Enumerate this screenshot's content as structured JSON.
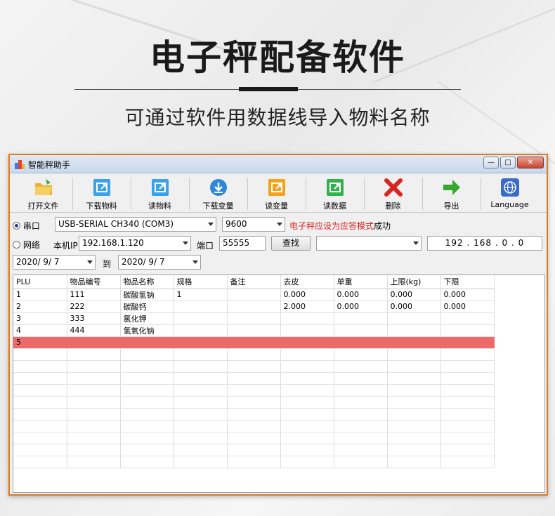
{
  "hero": {
    "title": "电子秤配备软件",
    "subtitle": "可通过软件用数据线导入物料名称"
  },
  "window": {
    "title": "智能秤助手",
    "controls": [
      "minimize",
      "restore",
      "close"
    ]
  },
  "toolbar": {
    "items": [
      {
        "label": "打开文件",
        "icon": "folder-open-icon",
        "color": "#e9b13a"
      },
      {
        "label": "下载物料",
        "icon": "download-item-icon",
        "color": "#3aa2e8"
      },
      {
        "label": "读物料",
        "icon": "read-item-icon",
        "color": "#3aa2e8"
      },
      {
        "label": "下载变量",
        "icon": "download-arrow-icon",
        "color": "#2b88d8"
      },
      {
        "label": "读变量",
        "icon": "read-variable-icon",
        "color": "#f2a21b"
      },
      {
        "label": "读数据",
        "icon": "read-data-icon",
        "color": "#2fb24b"
      },
      {
        "label": "删除",
        "icon": "delete-x-icon",
        "color": "#d8261e"
      },
      {
        "label": "导出",
        "icon": "export-arrow-icon",
        "color": "#36a832"
      },
      {
        "label": "Language",
        "icon": "globe-icon",
        "color": "#3a6bc8"
      }
    ]
  },
  "connection": {
    "serial_label": "串口",
    "serial_port": "USB-SERIAL CH340 (COM3)",
    "baud": "9600",
    "status_red": "电子秤应设为应答模式",
    "status_ok": "成功",
    "network_label": "网络",
    "local_ip_label": "本机IP",
    "local_ip": "192.168.1.120",
    "port_label": "端口",
    "port_value": "55555",
    "find_button": "查找",
    "found_select": "",
    "ip_octets": [
      "192",
      "168",
      "0",
      "0"
    ]
  },
  "dates": {
    "from": "2020/  9/  7",
    "to_label": "到",
    "to": "2020/  9/  7"
  },
  "table": {
    "columns": [
      "PLU",
      "物品编号",
      "物品名称",
      "规格",
      "备注",
      "去皮",
      "单重",
      "上限(kg)",
      "下限"
    ],
    "rows": [
      [
        "1",
        "111",
        "碳酸氢钠",
        "1",
        "",
        "0.000",
        "0.000",
        "0.000",
        "0.000"
      ],
      [
        "2",
        "222",
        "碳酸钙",
        "",
        "",
        "2.000",
        "0.000",
        "0.000",
        "0.000"
      ],
      [
        "3",
        "333",
        "氯化钾",
        "",
        "",
        "",
        "",
        "",
        ""
      ],
      [
        "4",
        "444",
        "氢氧化钠",
        "",
        "",
        "",
        "",
        "",
        ""
      ],
      [
        "5",
        "",
        "",
        "",
        "",
        "",
        "",
        "",
        ""
      ]
    ],
    "selected_row_index": 4,
    "selected_color": "#ee6a6a"
  }
}
